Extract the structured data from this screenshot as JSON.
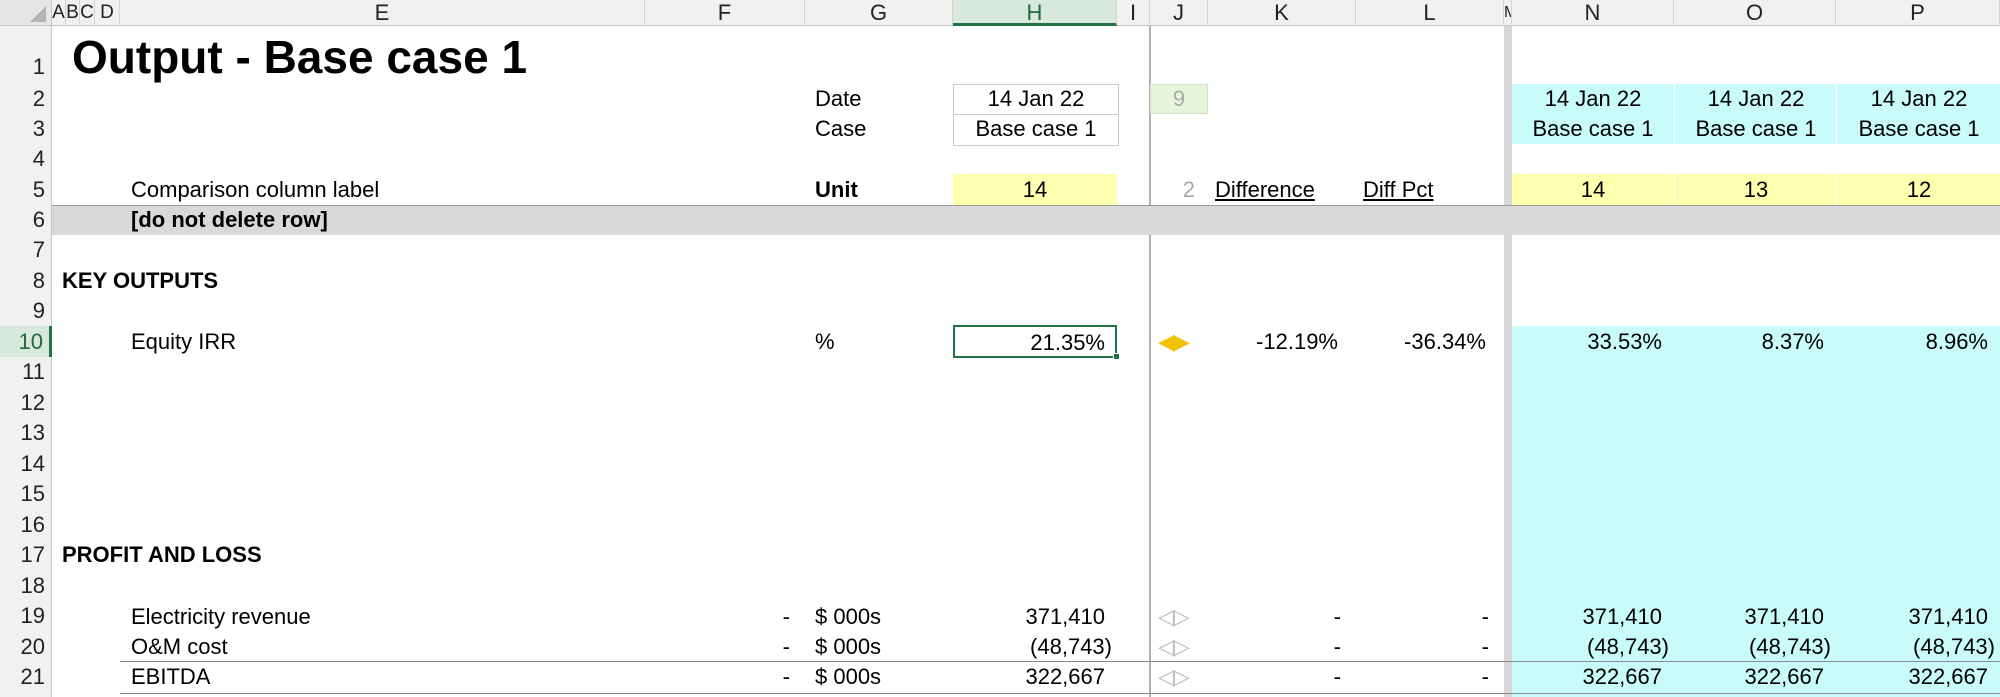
{
  "columns": [
    "A",
    "B",
    "C",
    "D",
    "E",
    "F",
    "G",
    "H",
    "I",
    "J",
    "K",
    "L",
    "M",
    "N",
    "O",
    "P"
  ],
  "rows": [
    "1",
    "2",
    "3",
    "4",
    "5",
    "6",
    "7",
    "8",
    "9",
    "10",
    "11",
    "12",
    "13",
    "14",
    "15",
    "16",
    "17",
    "18",
    "19",
    "20",
    "21"
  ],
  "title": "Output - Base case 1",
  "header": {
    "date_label": "Date",
    "date_value": "14 Jan 22",
    "case_label": "Case",
    "case_value": "Base case 1",
    "j_value": "9"
  },
  "row5": {
    "label": "Comparison column label",
    "unit_label": "Unit",
    "h_value": "14",
    "j_value": "2",
    "difference": "Difference",
    "diff_pct": "Diff Pct"
  },
  "row6": {
    "label": "[do not delete row]"
  },
  "sections": {
    "key_outputs": "KEY OUTPUTS",
    "profit_loss": "PROFIT AND LOSS"
  },
  "comparisons": [
    {
      "col": "N",
      "date": "14 Jan 22",
      "case": "Base case 1",
      "label": "14"
    },
    {
      "col": "O",
      "date": "14 Jan 22",
      "case": "Base case 1",
      "label": "13"
    },
    {
      "col": "P",
      "date": "14 Jan 22",
      "case": "Base case 1",
      "label": "12"
    }
  ],
  "data_rows": [
    {
      "row": "10",
      "label": "Equity IRR",
      "f": "",
      "unit": "%",
      "h": "21.35%",
      "diff": "-12.19%",
      "pct": "-36.34%",
      "n": "33.53%",
      "o": "8.37%",
      "p": "8.96%",
      "arrow": "◀▶"
    },
    {
      "row": "19",
      "label": "Electricity revenue",
      "f": "-",
      "unit": "$ 000s",
      "h": "371,410",
      "diff": "-",
      "pct": "-",
      "n": "371,410",
      "o": "371,410",
      "p": "371,410",
      "arrow": "◁▷"
    },
    {
      "row": "20",
      "label": "O&M cost",
      "f": "-",
      "unit": "$ 000s",
      "h": "(48,743)",
      "diff": "-",
      "pct": "-",
      "n": "(48,743)",
      "o": "(48,743)",
      "p": "(48,743)",
      "arrow": "◁▷"
    },
    {
      "row": "21",
      "label": "EBITDA",
      "f": "-",
      "unit": "$ 000s",
      "h": "322,667",
      "diff": "-",
      "pct": "-",
      "n": "322,667",
      "o": "322,667",
      "p": "322,667",
      "arrow": "◁▷"
    }
  ],
  "colors": {
    "yellow": "#ffffb0",
    "cyan": "#c9fbfb",
    "excel_green": "#217346",
    "arrow_gold": "#f2c200"
  }
}
